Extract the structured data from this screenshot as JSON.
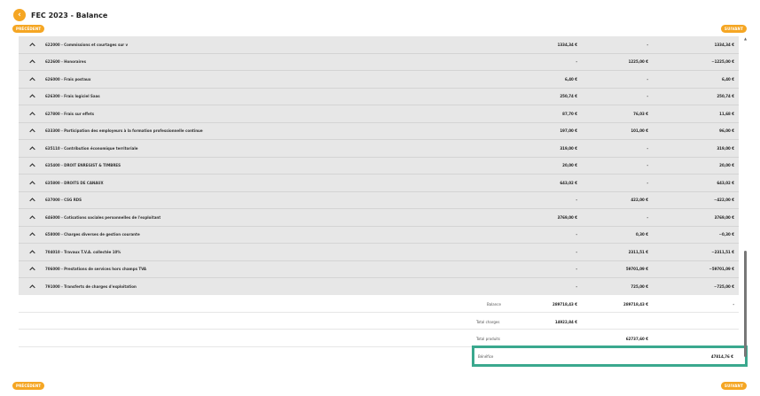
{
  "header": {
    "back_icon": "chevron-left-icon",
    "title": "FEC 2023 - Balance"
  },
  "nav": {
    "prev": "PRÉCÉDENT",
    "next": "SUIVANT"
  },
  "rows": [
    {
      "label": "622000 - Commissions et courtages sur v",
      "debit": "1334,34 €",
      "credit": "-",
      "solde": "1334,34 €"
    },
    {
      "label": "622600 - Honoraires",
      "debit": "-",
      "credit": "1225,00 €",
      "solde": "−1225,00 €"
    },
    {
      "label": "626000 - Frais postaux",
      "debit": "6,40 €",
      "credit": "-",
      "solde": "6,40 €"
    },
    {
      "label": "626300 - Frais logiciel Saas",
      "debit": "250,74 €",
      "credit": "-",
      "solde": "250,74 €"
    },
    {
      "label": "627800 - Frais sur effets",
      "debit": "87,70 €",
      "credit": "76,03 €",
      "solde": "11,68 €"
    },
    {
      "label": "633300 - Participation des employeurs à la formation professionnelle continue",
      "debit": "197,00 €",
      "credit": "101,00 €",
      "solde": "96,00 €"
    },
    {
      "label": "635110 - Contribution économique territoriale",
      "debit": "319,00 €",
      "credit": "-",
      "solde": "319,00 €"
    },
    {
      "label": "635400 - DROIT ENREGIST & TIMBRES",
      "debit": "20,00 €",
      "credit": "-",
      "solde": "20,00 €"
    },
    {
      "label": "635800 - DROITS DE CANAUX",
      "debit": "643,02 €",
      "credit": "-",
      "solde": "643,02 €"
    },
    {
      "label": "637000 - CSG RDS",
      "debit": "-",
      "credit": "422,00 €",
      "solde": "−422,00 €"
    },
    {
      "label": "646000 - Cotisations sociales personnelles de l'exploitant",
      "debit": "3769,00 €",
      "credit": "-",
      "solde": "3769,00 €"
    },
    {
      "label": "658000 - Charges diverses de gestion courante",
      "debit": "-",
      "credit": "0,30 €",
      "solde": "−0,30 €"
    },
    {
      "label": "704010 - Travaux T.V.A. collectée 10%",
      "debit": "-",
      "credit": "2311,51 €",
      "solde": "−2311,51 €"
    },
    {
      "label": "706000 - Prestations de services hors champs TVA",
      "debit": "-",
      "credit": "59701,09 €",
      "solde": "−59701,09 €"
    },
    {
      "label": "791000 - Transferts de charges d'exploitation",
      "debit": "-",
      "credit": "725,00 €",
      "solde": "−725,00 €"
    }
  ],
  "summary": {
    "balance": {
      "label": "Balance",
      "debit": "289718,43 €",
      "credit": "289718,43 €",
      "solde": "-"
    },
    "total_charges": {
      "label": "Total charges",
      "value": "14922,84 €"
    },
    "total_produits": {
      "label": "Total produits",
      "value": "62737,60 €"
    },
    "benefice": {
      "label": "Bénéfice",
      "value": "47814,76 €"
    }
  },
  "colors": {
    "accent": "#f5a623",
    "highlight": "#3aa88e"
  }
}
